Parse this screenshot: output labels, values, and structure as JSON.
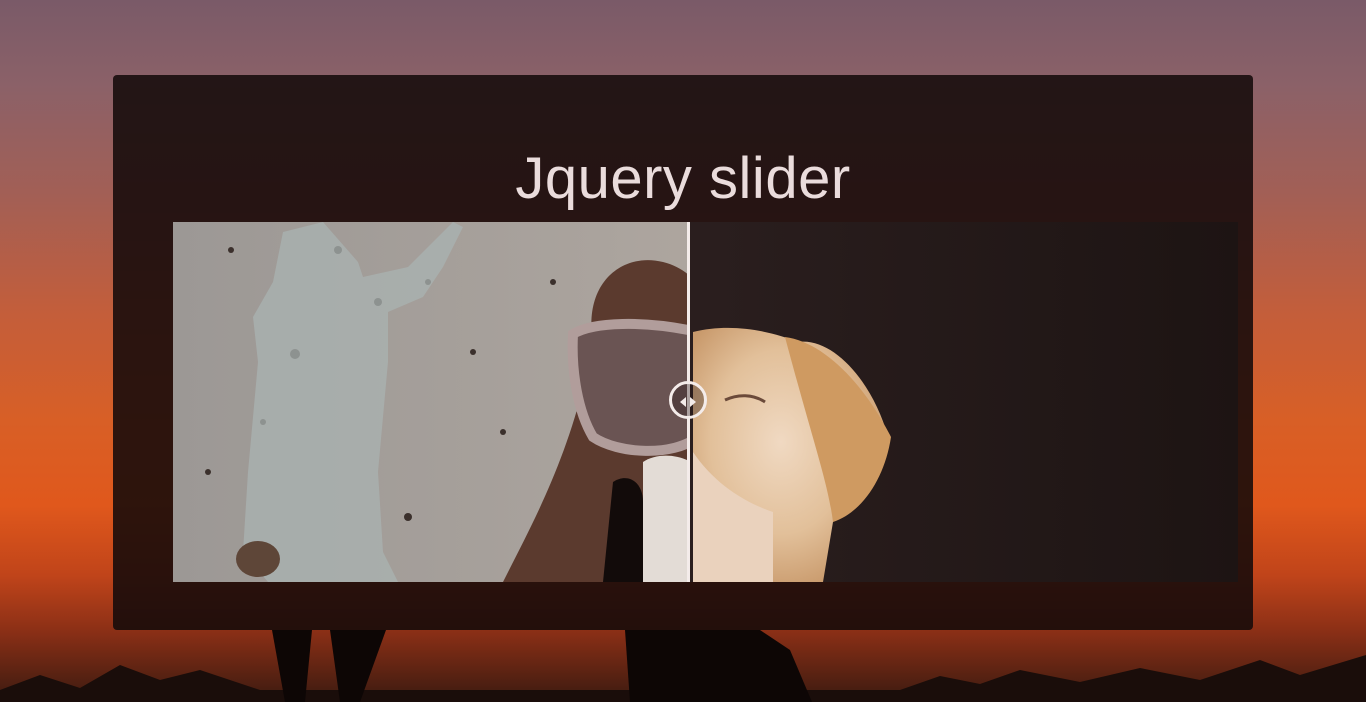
{
  "page": {
    "title": "Jquery slider"
  },
  "slider": {
    "position": 0.484,
    "before_image": "woman-and-dog-with-glasses",
    "after_image": "labrador-dog-closed-eyes",
    "handle_icon": "left-right-arrows-icon"
  },
  "colors": {
    "panel": "#140a0a",
    "title_text": "#eadcdc",
    "divider": "#f4ecea"
  }
}
